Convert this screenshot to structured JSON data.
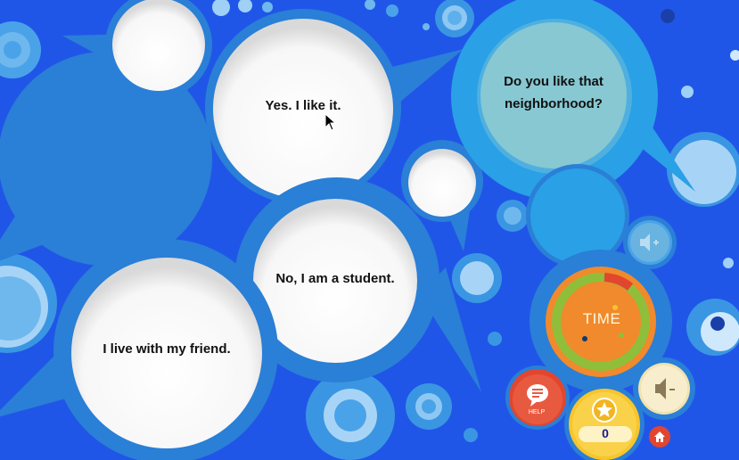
{
  "question": {
    "text_line1": "Do you like that",
    "text_line2": "neighborhood?"
  },
  "answers": [
    {
      "text": "Yes. I like it."
    },
    {
      "text": "No, I am a student."
    },
    {
      "text": "I live with my friend."
    },
    {
      "text": ""
    },
    {
      "text": ""
    }
  ],
  "controls": {
    "time_label": "TIME",
    "help_label": "HELP",
    "score": "0",
    "volume_up_icon": "speaker-plus-icon",
    "volume_down_icon": "speaker-minus-icon",
    "home_icon": "home-icon",
    "star_icon": "star-icon",
    "help_icon": "speech-bubble-icon"
  },
  "colors": {
    "background": "#2056e8",
    "bubble_blue": "#2a7fd6",
    "question_fill": "#87c8d2",
    "timer_orange": "#f08a2c",
    "timer_green": "#8fbf3a",
    "help_red": "#e2462f",
    "score_yellow": "#f7c52c"
  }
}
